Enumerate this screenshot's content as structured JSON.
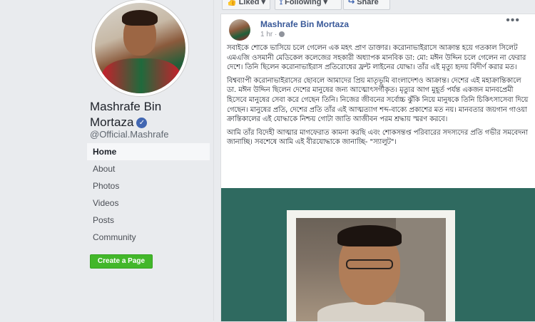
{
  "profile": {
    "name_line1": "Mashrafe Bin",
    "name_line2": "Mortaza",
    "verified_icon": "verified-badge-icon",
    "handle": "@Official.Mashrafe"
  },
  "nav": {
    "items": [
      {
        "label": "Home",
        "active": true
      },
      {
        "label": "About"
      },
      {
        "label": "Photos"
      },
      {
        "label": "Videos"
      },
      {
        "label": "Posts"
      },
      {
        "label": "Community"
      }
    ]
  },
  "create_page_label": "Create a Page",
  "actions": {
    "liked": "Liked ▾",
    "following": "Following ▾",
    "share": "Share"
  },
  "post": {
    "author": "Mashrafe Bin Mortaza",
    "time": "1 hr ·",
    "more": "•••",
    "paragraphs": [
      "সবাইকে শোকে ভাসিয়ে চলে গেলেন এক মহৎ প্রাণ ডাক্তার। করোনাভাইরাসে আক্রান্ত হয়ে গতকাল সিলেট এমএজি ওসমানী মেডিকেল কলেজের সহকারী অধ্যাপক মানবিক ডা: মো: মঈন উদ্দিন চলে গেলেন না ফেরার দেশে। তিনি ছিলেন করোনাভাইরাস প্রতিরোধের ফ্রন্ট লাইনের যোদ্ধা। তাঁর এই মৃত্যু হৃদয় বিদীর্ণ করার মত।",
      "বিশ্বব্যাপী করোনাভাইরাসের ছোবলে আমাদের প্রিয় মাতৃভূমি বাংলাদেশও আক্রান্ত। দেশের এই মহাক্রান্তিকালে ডা. মঈন উদ্দিন ছিলেন দেশের মানুষের জন্য আত্মোৎসর্গীকৃত। মৃত্যুর আগ মুহূর্ত পর্যন্ত একজন মানবপ্রেমী হিসেবে মানুষের সেবা করে গেছেন তিনি। নিজের জীবনের সর্বোচ্চ ঝুঁকি নিয়ে মানুষকে তিনি চিকিৎসাসেবা দিয়ে গেছেন। মানুষের প্রতি, দেশের প্রতি তাঁর এই আত্মত্যাগ শব্দ-বাক্যে প্রকাশের মত নয়। মানবতার জয়গান গাওয়া ক্রান্তিকালের এই যোদ্ধাকে নিশ্চয় গোটা জাতি আজীবন পরম শ্রদ্ধায় স্মরণ করবে।",
      "আমি তাঁর বিদেহী আত্মার মাগফেরাত কামনা করছি এবং শোকসন্তপ্ত পরিবারের সদস্যদের প্রতি গভীর সমবেদনা জানাচ্ছি। সবশেষে আমি এই বীরযোদ্ধাকে জানাচ্ছি- \"স্যালুট\"।"
    ]
  },
  "colors": {
    "fb_blue": "#4267b2",
    "link_blue": "#385898",
    "green": "#42b72a",
    "media_bg": "#2f6a60"
  }
}
